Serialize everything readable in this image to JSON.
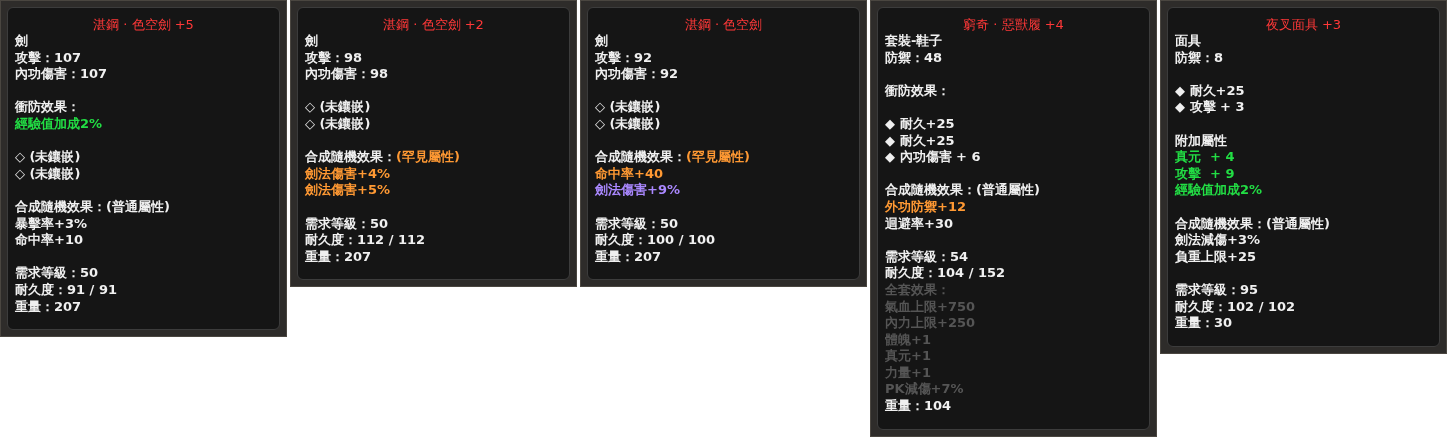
{
  "tooltips": [
    {
      "title": "湛鋼 · 色空劍 +5",
      "lines": [
        {
          "kind": "text",
          "text": "劍",
          "color": "#f0f0f0"
        },
        {
          "kind": "text",
          "text": "攻擊：107",
          "color": "#f0f0f0"
        },
        {
          "kind": "text",
          "text": "內功傷害：107",
          "color": "#f0f0f0"
        },
        {
          "kind": "gap"
        },
        {
          "kind": "text",
          "text": "衝防效果：",
          "color": "#f0f0f0"
        },
        {
          "kind": "text",
          "text": "經驗值加成2%",
          "color": "#22dd44"
        },
        {
          "kind": "gap"
        },
        {
          "kind": "text",
          "text": "◇ (未鑲嵌)",
          "color": "#f0f0f0"
        },
        {
          "kind": "text",
          "text": "◇ (未鑲嵌)",
          "color": "#f0f0f0"
        },
        {
          "kind": "gap"
        },
        {
          "kind": "text",
          "text": "合成隨機效果：(普通屬性)",
          "color": "#f0f0f0"
        },
        {
          "kind": "text",
          "text": "暴擊率+3%",
          "color": "#f0f0f0"
        },
        {
          "kind": "text",
          "text": "命中率+10",
          "color": "#f0f0f0"
        },
        {
          "kind": "gap"
        },
        {
          "kind": "text",
          "text": "需求等級：50",
          "color": "#f0f0f0"
        },
        {
          "kind": "text",
          "text": "耐久度：91 / 91",
          "color": "#f0f0f0"
        },
        {
          "kind": "text",
          "text": "重量：207",
          "color": "#f0f0f0"
        }
      ]
    },
    {
      "title": "湛鋼 · 色空劍 +2",
      "lines": [
        {
          "kind": "text",
          "text": "劍",
          "color": "#f0f0f0"
        },
        {
          "kind": "text",
          "text": "攻擊：98",
          "color": "#f0f0f0"
        },
        {
          "kind": "text",
          "text": "內功傷害：98",
          "color": "#f0f0f0"
        },
        {
          "kind": "gap"
        },
        {
          "kind": "text",
          "text": "◇ (未鑲嵌)",
          "color": "#f0f0f0"
        },
        {
          "kind": "text",
          "text": "◇ (未鑲嵌)",
          "color": "#f0f0f0"
        },
        {
          "kind": "gap"
        },
        {
          "kind": "text",
          "text": "合成隨機效果：",
          "color": "#f0f0f0",
          "extra": {
            "text": "(罕見屬性)",
            "color": "#ff9933"
          }
        },
        {
          "kind": "text",
          "text": "劍法傷害+4%",
          "color": "#ff9933"
        },
        {
          "kind": "text",
          "text": "劍法傷害+5%",
          "color": "#ff9933"
        },
        {
          "kind": "gap"
        },
        {
          "kind": "text",
          "text": "需求等級：50",
          "color": "#f0f0f0"
        },
        {
          "kind": "text",
          "text": "耐久度：112 / 112",
          "color": "#f0f0f0"
        },
        {
          "kind": "text",
          "text": "重量：207",
          "color": "#f0f0f0"
        }
      ]
    },
    {
      "title": "湛鋼 · 色空劍",
      "lines": [
        {
          "kind": "text",
          "text": "劍",
          "color": "#f0f0f0"
        },
        {
          "kind": "text",
          "text": "攻擊：92",
          "color": "#f0f0f0"
        },
        {
          "kind": "text",
          "text": "內功傷害：92",
          "color": "#f0f0f0"
        },
        {
          "kind": "gap"
        },
        {
          "kind": "text",
          "text": "◇ (未鑲嵌)",
          "color": "#f0f0f0"
        },
        {
          "kind": "text",
          "text": "◇ (未鑲嵌)",
          "color": "#f0f0f0"
        },
        {
          "kind": "gap"
        },
        {
          "kind": "text",
          "text": "合成隨機效果：",
          "color": "#f0f0f0",
          "extra": {
            "text": "(罕見屬性)",
            "color": "#ff9933"
          }
        },
        {
          "kind": "text",
          "text": "命中率+40",
          "color": "#ff9933"
        },
        {
          "kind": "text",
          "text": "劍法傷害+9%",
          "color": "#aa88ff"
        },
        {
          "kind": "gap"
        },
        {
          "kind": "text",
          "text": "需求等級：50",
          "color": "#f0f0f0"
        },
        {
          "kind": "text",
          "text": "耐久度：100 / 100",
          "color": "#f0f0f0"
        },
        {
          "kind": "text",
          "text": "重量：207",
          "color": "#f0f0f0"
        }
      ]
    },
    {
      "title": "窮奇 · 惡獸履 +4",
      "lines": [
        {
          "kind": "text",
          "text": "套裝-鞋子",
          "color": "#f0f0f0"
        },
        {
          "kind": "text",
          "text": "防禦：48",
          "color": "#f0f0f0"
        },
        {
          "kind": "gap"
        },
        {
          "kind": "text",
          "text": "衝防效果：",
          "color": "#f0f0f0"
        },
        {
          "kind": "gap"
        },
        {
          "kind": "text",
          "text": "◆ 耐久+25",
          "color": "#f0f0f0"
        },
        {
          "kind": "text",
          "text": "◆ 耐久+25",
          "color": "#f0f0f0"
        },
        {
          "kind": "text",
          "text": "◆ 內功傷害 + 6",
          "color": "#f0f0f0"
        },
        {
          "kind": "gap"
        },
        {
          "kind": "text",
          "text": "合成隨機效果：(普通屬性)",
          "color": "#f0f0f0"
        },
        {
          "kind": "text",
          "text": "外功防禦+12",
          "color": "#ff9933"
        },
        {
          "kind": "text",
          "text": "迴避率+30",
          "color": "#f0f0f0"
        },
        {
          "kind": "gap"
        },
        {
          "kind": "text",
          "text": "需求等級：54",
          "color": "#f0f0f0"
        },
        {
          "kind": "text",
          "text": "耐久度：104 / 152",
          "color": "#f0f0f0"
        },
        {
          "kind": "text",
          "text": "全套效果：",
          "color": "#555555"
        },
        {
          "kind": "text",
          "text": "氣血上限+750",
          "color": "#555555"
        },
        {
          "kind": "text",
          "text": "內力上限+250",
          "color": "#555555"
        },
        {
          "kind": "text",
          "text": "體魄+1",
          "color": "#555555"
        },
        {
          "kind": "text",
          "text": "真元+1",
          "color": "#555555"
        },
        {
          "kind": "text",
          "text": "力量+1",
          "color": "#555555"
        },
        {
          "kind": "text",
          "text": "PK減傷+7%",
          "color": "#555555"
        },
        {
          "kind": "text",
          "text": "重量：104",
          "color": "#f0f0f0"
        }
      ]
    },
    {
      "title": "夜叉面具 +3",
      "lines": [
        {
          "kind": "text",
          "text": "面具",
          "color": "#f0f0f0"
        },
        {
          "kind": "text",
          "text": "防禦：8",
          "color": "#f0f0f0"
        },
        {
          "kind": "gap"
        },
        {
          "kind": "text",
          "text": "◆ 耐久+25",
          "color": "#f0f0f0"
        },
        {
          "kind": "text",
          "text": "◆ 攻擊 + 3",
          "color": "#f0f0f0"
        },
        {
          "kind": "gap"
        },
        {
          "kind": "text",
          "text": "附加屬性",
          "color": "#f0f0f0"
        },
        {
          "kind": "text",
          "text": "真元  + 4",
          "color": "#22dd44"
        },
        {
          "kind": "text",
          "text": "攻擊  + 9",
          "color": "#22dd44"
        },
        {
          "kind": "text",
          "text": "經驗值加成2%",
          "color": "#22dd44"
        },
        {
          "kind": "gap"
        },
        {
          "kind": "text",
          "text": "合成隨機效果：(普通屬性)",
          "color": "#f0f0f0"
        },
        {
          "kind": "text",
          "text": "劍法減傷+3%",
          "color": "#f0f0f0"
        },
        {
          "kind": "text",
          "text": "負重上限+25",
          "color": "#f0f0f0"
        },
        {
          "kind": "gap"
        },
        {
          "kind": "text",
          "text": "需求等級：95",
          "color": "#f0f0f0"
        },
        {
          "kind": "text",
          "text": "耐久度：102 / 102",
          "color": "#f0f0f0"
        },
        {
          "kind": "text",
          "text": "重量：30",
          "color": "#f0f0f0"
        }
      ]
    }
  ]
}
